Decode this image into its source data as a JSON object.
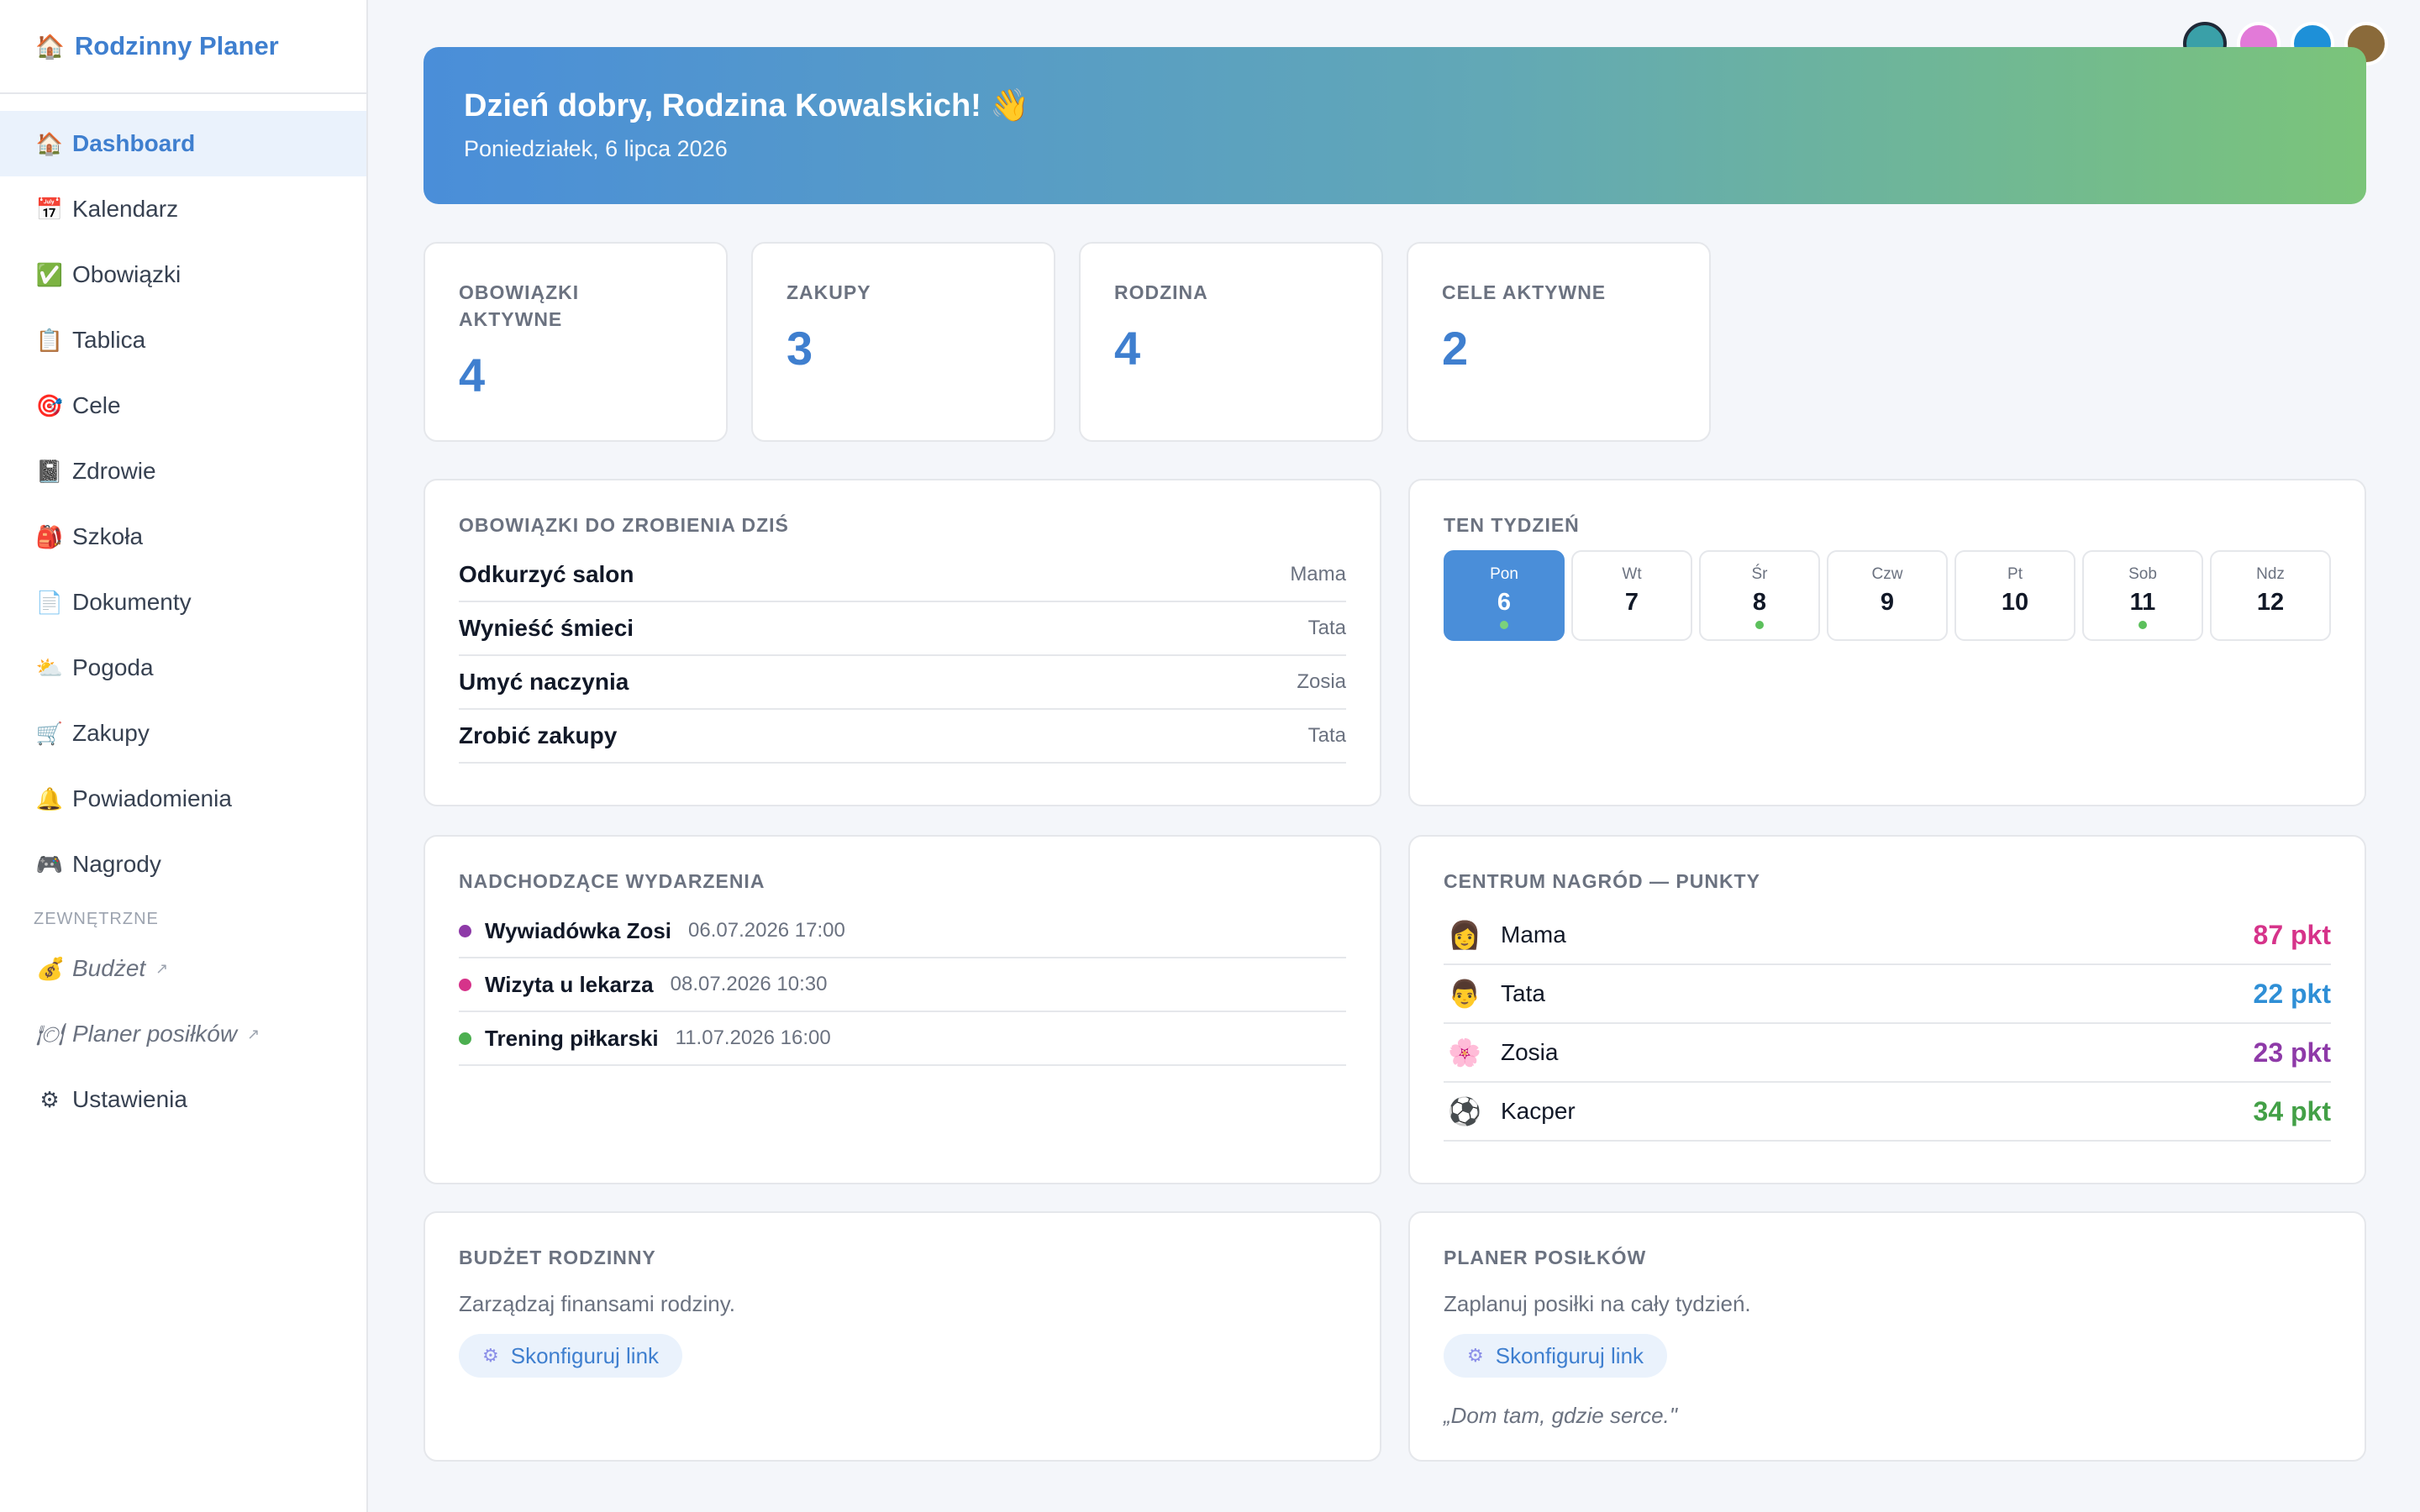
{
  "brand": {
    "icon": "house-icon",
    "name": "Rodzinny Planer"
  },
  "sidebar": {
    "items": [
      {
        "name": "dashboard",
        "icon": "🏠",
        "label": "Dashboard",
        "active": true
      },
      {
        "name": "kalendarz",
        "icon": "📅",
        "label": "Kalendarz"
      },
      {
        "name": "obowiazki",
        "icon": "✅",
        "label": "Obowiązki"
      },
      {
        "name": "tablica",
        "icon": "📋",
        "label": "Tablica"
      },
      {
        "name": "cele",
        "icon": "🎯",
        "label": "Cele"
      },
      {
        "name": "zdrowie",
        "icon": "📓",
        "label": "Zdrowie"
      },
      {
        "name": "szkola",
        "icon": "🎒",
        "label": "Szkoła"
      },
      {
        "name": "dokumenty",
        "icon": "📄",
        "label": "Dokumenty"
      },
      {
        "name": "pogoda",
        "icon": "⛅",
        "label": "Pogoda"
      },
      {
        "name": "zakupy",
        "icon": "🛒",
        "label": "Zakupy"
      },
      {
        "name": "powiadomienia",
        "icon": "🔔",
        "label": "Powiadomienia"
      },
      {
        "name": "nagrody",
        "icon": "🎮",
        "label": "Nagrody"
      }
    ],
    "section_label": "ZEWNĘTRZNE",
    "external": [
      {
        "name": "budzet",
        "icon": "💰",
        "label": "Budżet",
        "arrow": "↗"
      },
      {
        "name": "planer-posilkow",
        "icon": "🍽",
        "label": "Planer posiłków",
        "arrow": "↗"
      }
    ],
    "settings": {
      "icon": "⚙",
      "label": "Ustawienia"
    }
  },
  "avatars": [
    {
      "color": "#3aa0a8"
    },
    {
      "color": "#e27ad8"
    },
    {
      "color": "#1e90d8"
    },
    {
      "color": "#8a6a3a"
    }
  ],
  "hero": {
    "title": "Dzień dobry, Rodzina Kowalskich! 👋",
    "date": "Poniedziałek, 6 lipca 2026"
  },
  "stats": [
    {
      "label": "OBOWIĄZKI AKTYWNE",
      "value": "4"
    },
    {
      "label": "ZAKUPY",
      "value": "3"
    },
    {
      "label": "RODZINA",
      "value": "4"
    },
    {
      "label": "CELE AKTYWNE",
      "value": "2"
    }
  ],
  "chores": {
    "title": "OBOWIĄZKI DO ZROBIENIA DZIŚ",
    "items": [
      {
        "task": "Odkurzyć salon",
        "who": "Mama"
      },
      {
        "task": "Wynieść śmieci",
        "who": "Tata"
      },
      {
        "task": "Umyć naczynia",
        "who": "Zosia"
      },
      {
        "task": "Zrobić zakupy",
        "who": "Tata"
      }
    ]
  },
  "week": {
    "title": "TEN TYDZIEŃ",
    "days": [
      {
        "name": "Pon",
        "date": "6",
        "today": true,
        "event": true
      },
      {
        "name": "Wt",
        "date": "7",
        "today": false,
        "event": false
      },
      {
        "name": "Śr",
        "date": "8",
        "today": false,
        "event": true
      },
      {
        "name": "Czw",
        "date": "9",
        "today": false,
        "event": false
      },
      {
        "name": "Pt",
        "date": "10",
        "today": false,
        "event": false
      },
      {
        "name": "Sob",
        "date": "11",
        "today": false,
        "event": true
      },
      {
        "name": "Ndz",
        "date": "12",
        "today": false,
        "event": false
      }
    ]
  },
  "events": {
    "title": "NADCHODZĄCE WYDARZENIA",
    "items": [
      {
        "name": "Wywiadówka Zosi",
        "date": "06.07.2026 17:00",
        "color": "#8e3aa8"
      },
      {
        "name": "Wizyta u lekarza",
        "date": "08.07.2026 10:30",
        "color": "#d6338a"
      },
      {
        "name": "Trening piłkarski",
        "date": "11.07.2026 16:00",
        "color": "#4caf50"
      }
    ]
  },
  "rewards": {
    "title": "CENTRUM NAGRÓD — PUNKTY",
    "members": [
      {
        "emoji": "👩",
        "name": "Mama",
        "points": "87 pkt",
        "color": "#d6338a"
      },
      {
        "emoji": "👨",
        "name": "Tata",
        "points": "22 pkt",
        "color": "#2f8fd6"
      },
      {
        "emoji": "🌸",
        "name": "Zosia",
        "points": "23 pkt",
        "color": "#8e3aa8"
      },
      {
        "emoji": "⚽",
        "name": "Kacper",
        "points": "34 pkt",
        "color": "#43a047"
      }
    ]
  },
  "budget": {
    "title": "BUDŻET RODZINNY",
    "desc": "Zarządzaj finansami rodziny.",
    "button": "Skonfiguruj link"
  },
  "meals": {
    "title": "PLANER POSIŁKÓW",
    "desc": "Zaplanuj posiłki na cały tydzień.",
    "button": "Skonfiguruj link",
    "quote": "„Dom tam, gdzie serce.\""
  }
}
